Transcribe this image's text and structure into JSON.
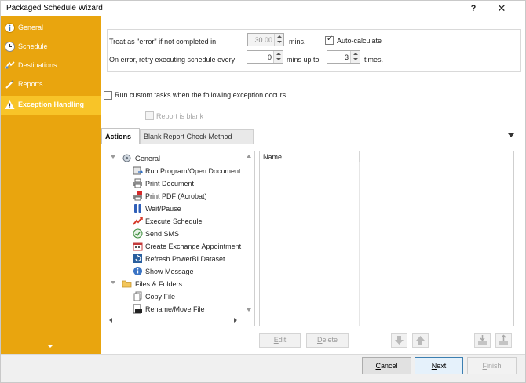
{
  "window": {
    "title": "Packaged Schedule Wizard",
    "help_label": "?",
    "close_label": "✕"
  },
  "sidebar": {
    "items": [
      {
        "label": "General",
        "icon": "info-icon",
        "active": false
      },
      {
        "label": "Schedule",
        "icon": "clock-icon",
        "active": false
      },
      {
        "label": "Destinations",
        "icon": "destinations-icon",
        "active": false
      },
      {
        "label": "Reports",
        "icon": "reports-icon",
        "active": false
      },
      {
        "label": "Exception Handling",
        "icon": "warning-icon",
        "active": true
      }
    ],
    "accent": "#e9a50e",
    "active_bg": "#f8c428"
  },
  "options": {
    "treat_as_error_label": "Treat as \"error\" if not completed in",
    "timeout_value": "30.00",
    "mins_label": "mins.",
    "auto_calculate_label": "Auto-calculate",
    "auto_calculate_checked": true,
    "retry_label": "On error, retry  executing schedule every",
    "retry_every_value": "0",
    "mins_up_to_label": "mins up to",
    "retry_times_value": "3",
    "times_label": "times."
  },
  "custom_tasks": {
    "label": "Run custom tasks when the following exception occurs",
    "checked": false,
    "report_blank_label": "Report is blank",
    "report_blank_checked": false
  },
  "tabs": [
    {
      "label": "Actions",
      "active": true
    },
    {
      "label": "Blank Report Check Method",
      "active": false
    }
  ],
  "tree": {
    "groups": [
      {
        "label": "General",
        "icon": "gear-icon",
        "items": [
          {
            "label": "Run Program/Open Document",
            "icon": "run-program-icon"
          },
          {
            "label": "Print Document",
            "icon": "printer-icon"
          },
          {
            "label": "Print PDF (Acrobat)",
            "icon": "pdf-printer-icon"
          },
          {
            "label": "Wait/Pause",
            "icon": "pause-icon"
          },
          {
            "label": "Execute Schedule",
            "icon": "execute-schedule-icon"
          },
          {
            "label": "Send SMS",
            "icon": "sms-icon"
          },
          {
            "label": "Create Exchange Appointment",
            "icon": "calendar-icon"
          },
          {
            "label": "Refresh PowerBI Dataset",
            "icon": "refresh-icon"
          },
          {
            "label": "Show Message",
            "icon": "info-bubble-icon"
          }
        ]
      },
      {
        "label": "Files & Folders",
        "icon": "folder-icon",
        "items": [
          {
            "label": "Copy File",
            "icon": "copy-file-icon"
          },
          {
            "label": "Rename/Move File",
            "icon": "rename-file-icon"
          }
        ]
      }
    ]
  },
  "grid": {
    "columns": [
      "Name",
      ""
    ]
  },
  "grid_buttons": {
    "edit_label_underlined": "E",
    "edit_label_rest": "dit",
    "delete_label_underlined": "D",
    "delete_label_rest": "elete"
  },
  "footer": {
    "cancel_label_underlined": "C",
    "cancel_label_rest": "ancel",
    "next_label_underlined": "N",
    "next_label_rest": "ext",
    "finish_label_underlined": "F",
    "finish_label_rest": "inish"
  }
}
